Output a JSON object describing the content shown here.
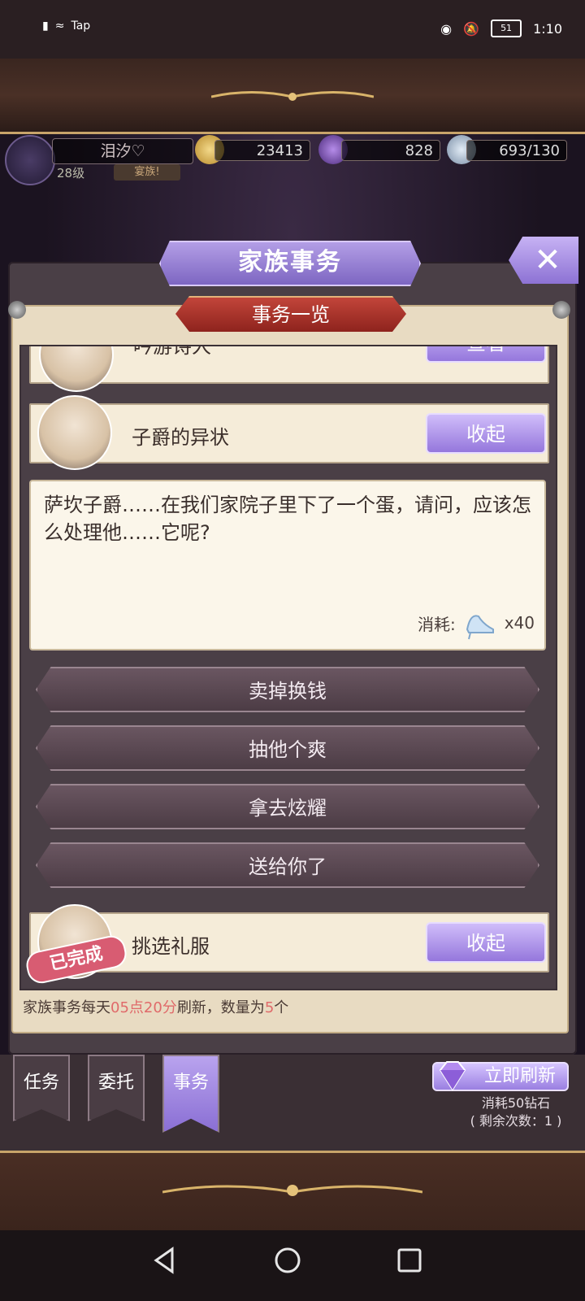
{
  "status_bar": {
    "carrier": "Tap",
    "time": "1:10",
    "battery": "51"
  },
  "player": {
    "name": "泪汐♡",
    "level": "28级",
    "guild": "宴族!"
  },
  "resources": {
    "gold": "23413",
    "diamonds": "828",
    "stamina": "693/130"
  },
  "panel": {
    "title": "家族事务",
    "subtitle": "事务一览",
    "close": "✕"
  },
  "items": [
    {
      "title": "吟游诗人",
      "button": "查看"
    },
    {
      "title": "子爵的异状",
      "button": "收起"
    },
    {
      "title": "挑选礼服",
      "button": "收起",
      "status": "已完成"
    }
  ],
  "detail": {
    "text": "萨坎子爵……在我们家院子里下了一个蛋，请问，应该怎么处理他……它呢?",
    "cost_label": "消耗:",
    "cost_amount": "x40"
  },
  "choices": [
    "卖掉换钱",
    "抽他个爽",
    "拿去炫耀",
    "送给你了"
  ],
  "footer": {
    "prefix": "家族事务每天",
    "time": "05点20分",
    "middle": "刷新，数量为",
    "count": "5",
    "suffix": "个"
  },
  "tabs": [
    "任务",
    "委托",
    "事务"
  ],
  "refresh": {
    "label": "立即刷新",
    "cost": "消耗50钻石",
    "remaining": "( 剩余次数：1 )"
  },
  "colors": {
    "accent_purple": "#9577dc",
    "ribbon_red": "#a8322a",
    "parchment": "#e8dbc2",
    "highlight": "#e06a6a"
  }
}
